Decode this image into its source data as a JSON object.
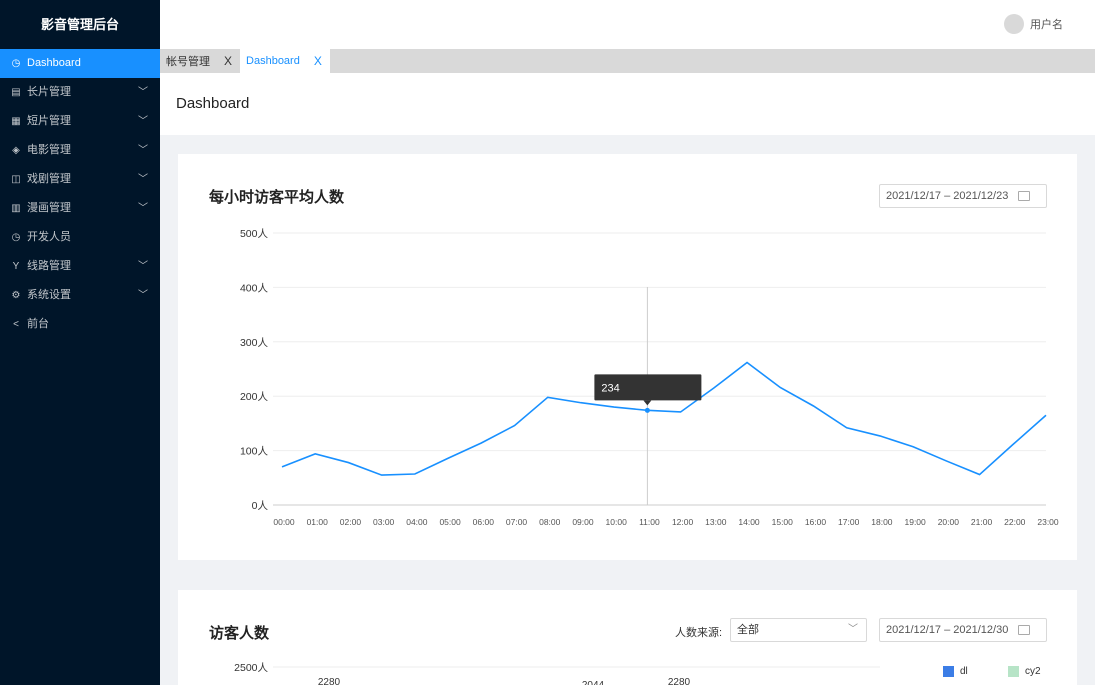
{
  "app": {
    "title": "影音管理后台"
  },
  "sidebar": {
    "items": [
      {
        "label": "Dashboard",
        "icon": "dashboard-icon",
        "glyph": "◷",
        "chevron": false,
        "active": true
      },
      {
        "label": "长片管理",
        "icon": "film-icon",
        "glyph": "▤",
        "chevron": true
      },
      {
        "label": "短片管理",
        "icon": "clapper-icon",
        "glyph": "▦",
        "chevron": true
      },
      {
        "label": "电影管理",
        "icon": "ticket-icon",
        "glyph": "◈",
        "chevron": true
      },
      {
        "label": "戏剧管理",
        "icon": "tv-icon",
        "glyph": "◫",
        "chevron": true
      },
      {
        "label": "漫画管理",
        "icon": "book-icon",
        "glyph": "▥",
        "chevron": true
      },
      {
        "label": "开发人员",
        "icon": "developer-icon",
        "glyph": "◷",
        "chevron": false
      },
      {
        "label": "线路管理",
        "icon": "branch-icon",
        "glyph": "Y",
        "chevron": true
      },
      {
        "label": "系统设置",
        "icon": "gear-icon",
        "glyph": "⚙",
        "chevron": true
      },
      {
        "label": "前台",
        "icon": "back-icon",
        "glyph": "<",
        "chevron": false
      }
    ]
  },
  "header": {
    "user": "用户名"
  },
  "tabs": [
    {
      "label": "帐号管理",
      "close": "X",
      "active": false
    },
    {
      "label": "Dashboard",
      "close": "X",
      "active": true
    }
  ],
  "page": {
    "title": "Dashboard"
  },
  "card1": {
    "title": "每小时访客平均人数",
    "range": "2021/12/17 – 2021/12/23"
  },
  "card2": {
    "title": "访客人数",
    "source_label": "人数来源:",
    "source_value": "全部",
    "range": "2021/12/17 – 2021/12/30",
    "legend": [
      {
        "name": "dl",
        "color": "#3b7de6"
      },
      {
        "name": "cy2",
        "color": "#b7e4c7"
      }
    ]
  },
  "colors": {
    "accent": "#1890ff",
    "sidebar": "#001529"
  },
  "chart_data": [
    {
      "type": "line",
      "title": "每小时访客平均人数",
      "categories": [
        "00:00",
        "01:00",
        "02:00",
        "03:00",
        "04:00",
        "05:00",
        "06:00",
        "07:00",
        "08:00",
        "09:00",
        "10:00",
        "11:00",
        "12:00",
        "13:00",
        "14:00",
        "15:00",
        "16:00",
        "17:00",
        "18:00",
        "19:00",
        "20:00",
        "21:00",
        "22:00",
        "23:00"
      ],
      "values": [
        70,
        94,
        78,
        55,
        57,
        86,
        114,
        146,
        198,
        188,
        180,
        174,
        171,
        215,
        262,
        216,
        182,
        142,
        127,
        107,
        81,
        56,
        111,
        165
      ],
      "y_ticks": [
        "0人",
        "100人",
        "200人",
        "300人",
        "400人",
        "500人"
      ],
      "ylim": [
        0,
        500
      ],
      "tooltip": {
        "category": "11:00",
        "text": "234"
      },
      "grid": true
    },
    {
      "type": "bar",
      "title": "访客人数",
      "y_ticks_visible": [
        "2500人"
      ],
      "data_labels_visible": [
        "2280",
        "2044",
        "2280"
      ],
      "series": [
        {
          "name": "dl"
        },
        {
          "name": "cy2"
        }
      ]
    }
  ]
}
